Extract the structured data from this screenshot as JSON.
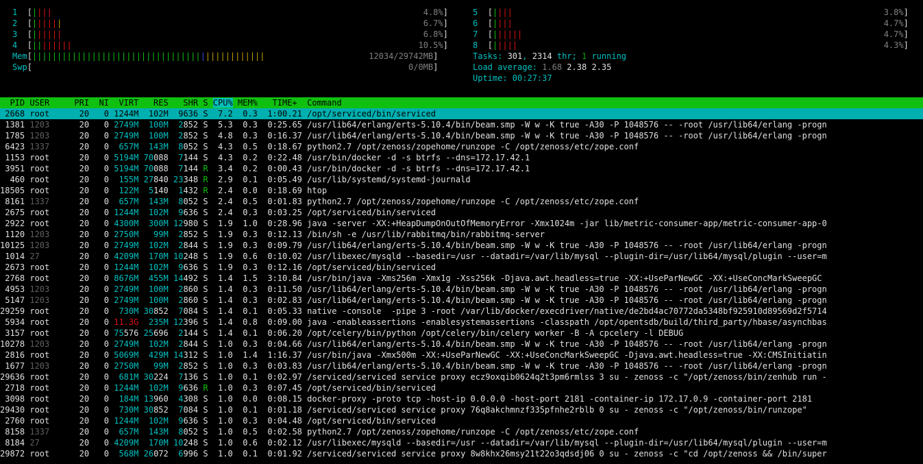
{
  "meters": {
    "cpus_left": [
      {
        "id": "1",
        "bars_green": "|",
        "bars_red": "|||",
        "pct": "4.8%"
      },
      {
        "id": "2",
        "bars_green": "|",
        "bars_red": "||||",
        "bars_yel": "|",
        "pct": "6.7%"
      },
      {
        "id": "3",
        "bars_green": "|",
        "bars_red": "|||||",
        "pct": "6.8%"
      },
      {
        "id": "4",
        "bars_green": "||",
        "bars_red": "||||||",
        "pct": "10.5%"
      }
    ],
    "cpus_right": [
      {
        "id": "5",
        "bars_green": "|",
        "bars_red": "|||",
        "pct": "3.8%"
      },
      {
        "id": "6",
        "bars_green": "|",
        "bars_red": "|||",
        "pct": "4.7%"
      },
      {
        "id": "7",
        "bars_green": "|",
        "bars_red": "|||||",
        "pct": "4.7%"
      },
      {
        "id": "8",
        "bars_green": "|",
        "bars_red": "||||",
        "pct": "4.3%"
      }
    ],
    "mem": {
      "label": "Mem",
      "bars_green": "||||||||||||||||||||||||||||||||||",
      "bars_blue": "|",
      "bars_yel": "||||||||||||",
      "value": "12034/29742MB"
    },
    "swp": {
      "label": "Swp",
      "value": "0/0MB"
    }
  },
  "summary": {
    "tasks_label": "Tasks:",
    "tasks": "301",
    "thr": "2314",
    "thr_label": "thr;",
    "running": "1",
    "running_label": "running",
    "load_label": "Load average:",
    "load1": "1.68",
    "load5": "2.38",
    "load15": "2.35",
    "uptime_label": "Uptime:",
    "uptime": "00:27:37"
  },
  "columns": [
    "PID",
    "USER",
    "PRI",
    "NI",
    "VIRT",
    "RES",
    "SHR",
    "S",
    "CPU%",
    "MEM%",
    "TIME+",
    "Command"
  ],
  "processes": [
    {
      "pid": "2668",
      "user": "root",
      "pri": "20",
      "ni": "0",
      "virt": "1244M",
      "res": "102M",
      "shr": "9636",
      "s": "S",
      "cpu": "7.2",
      "mem": "0.3",
      "time": "1:00.21",
      "cmd": "/opt/serviced/bin/serviced"
    },
    {
      "pid": "1381",
      "user": "1203",
      "pri": "20",
      "ni": "0",
      "virt": "2749M",
      "res": "100M",
      "shr": "2852",
      "s": "S",
      "cpu": "5.3",
      "mem": "0.3",
      "time": "0:25.65",
      "cmd": "/usr/lib64/erlang/erts-5.10.4/bin/beam.smp -W w -K true -A30 -P 1048576 -- -root /usr/lib64/erlang -progn"
    },
    {
      "pid": "1785",
      "user": "1203",
      "pri": "20",
      "ni": "0",
      "virt": "2749M",
      "res": "100M",
      "shr": "2852",
      "s": "S",
      "cpu": "4.8",
      "mem": "0.3",
      "time": "0:16.37",
      "cmd": "/usr/lib64/erlang/erts-5.10.4/bin/beam.smp -W w -K true -A30 -P 1048576 -- -root /usr/lib64/erlang -progn"
    },
    {
      "pid": "6423",
      "user": "1337",
      "pri": "20",
      "ni": "0",
      "virt": "657M",
      "res": "143M",
      "shr": "8052",
      "s": "S",
      "cpu": "4.3",
      "mem": "0.5",
      "time": "0:18.67",
      "cmd": "python2.7 /opt/zenoss/zopehome/runzope -C /opt/zenoss/etc/zope.conf"
    },
    {
      "pid": "1153",
      "user": "root",
      "pri": "20",
      "ni": "0",
      "virt": "5194M",
      "res": "70088",
      "shr": "7144",
      "s": "S",
      "cpu": "4.3",
      "mem": "0.2",
      "time": "0:22.48",
      "cmd": "/usr/bin/docker -d -s btrfs --dns=172.17.42.1"
    },
    {
      "pid": "3951",
      "user": "root",
      "pri": "20",
      "ni": "0",
      "virt": "5194M",
      "res": "70088",
      "shr": "7144",
      "s": "R",
      "cpu": "3.4",
      "mem": "0.2",
      "time": "0:00.43",
      "cmd": "/usr/bin/docker -d -s btrfs --dns=172.17.42.1"
    },
    {
      "pid": "460",
      "user": "root",
      "pri": "20",
      "ni": "0",
      "virt": "155M",
      "res": "27840",
      "shr": "23348",
      "s": "R",
      "cpu": "2.9",
      "mem": "0.1",
      "time": "0:05.49",
      "cmd": "/usr/lib/systemd/systemd-journald"
    },
    {
      "pid": "18505",
      "user": "root",
      "pri": "20",
      "ni": "0",
      "virt": "122M",
      "res": "5140",
      "shr": "1432",
      "s": "R",
      "cpu": "2.4",
      "mem": "0.0",
      "time": "0:18.69",
      "cmd": "htop"
    },
    {
      "pid": "8161",
      "user": "1337",
      "pri": "20",
      "ni": "0",
      "virt": "657M",
      "res": "143M",
      "shr": "8052",
      "s": "S",
      "cpu": "2.4",
      "mem": "0.5",
      "time": "0:01.83",
      "cmd": "python2.7 /opt/zenoss/zopehome/runzope -C /opt/zenoss/etc/zope.conf"
    },
    {
      "pid": "2675",
      "user": "root",
      "pri": "20",
      "ni": "0",
      "virt": "1244M",
      "res": "102M",
      "shr": "9636",
      "s": "S",
      "cpu": "2.4",
      "mem": "0.3",
      "time": "0:03.25",
      "cmd": "/opt/serviced/bin/serviced"
    },
    {
      "pid": "2922",
      "user": "root",
      "pri": "20",
      "ni": "0",
      "virt": "4300M",
      "res": "300M",
      "shr": "12980",
      "s": "S",
      "cpu": "1.9",
      "mem": "1.0",
      "time": "0:28.96",
      "cmd": "java -server -XX:+HeapDumpOnOutOfMemoryError -Xmx1024m -jar lib/metric-consumer-app/metric-consumer-app-0"
    },
    {
      "pid": "1120",
      "user": "1203",
      "pri": "20",
      "ni": "0",
      "virt": "2750M",
      "res": "99M",
      "shr": "2852",
      "s": "S",
      "cpu": "1.9",
      "mem": "0.3",
      "time": "0:12.13",
      "cmd": "/bin/sh -e /usr/lib/rabbitmq/bin/rabbitmq-server"
    },
    {
      "pid": "10125",
      "user": "1203",
      "pri": "20",
      "ni": "0",
      "virt": "2749M",
      "res": "102M",
      "shr": "2844",
      "s": "S",
      "cpu": "1.9",
      "mem": "0.3",
      "time": "0:09.79",
      "cmd": "/usr/lib64/erlang/erts-5.10.4/bin/beam.smp -W w -K true -A30 -P 1048576 -- -root /usr/lib64/erlang -progn"
    },
    {
      "pid": "1014",
      "user": "27",
      "pri": "20",
      "ni": "0",
      "virt": "4209M",
      "res": "170M",
      "shr": "10248",
      "s": "S",
      "cpu": "1.9",
      "mem": "0.6",
      "time": "0:10.02",
      "cmd": "/usr/libexec/mysqld --basedir=/usr --datadir=/var/lib/mysql --plugin-dir=/usr/lib64/mysql/plugin --user=m"
    },
    {
      "pid": "2673",
      "user": "root",
      "pri": "20",
      "ni": "0",
      "virt": "1244M",
      "res": "102M",
      "shr": "9636",
      "s": "S",
      "cpu": "1.9",
      "mem": "0.3",
      "time": "0:12.16",
      "cmd": "/opt/serviced/bin/serviced"
    },
    {
      "pid": "2768",
      "user": "root",
      "pri": "20",
      "ni": "0",
      "virt": "8676M",
      "res": "455M",
      "shr": "14492",
      "s": "S",
      "cpu": "1.4",
      "mem": "1.5",
      "time": "3:10.84",
      "cmd": "/usr/bin/java -Xms256m -Xmx1g -Xss256k -Djava.awt.headless=true -XX:+UseParNewGC -XX:+UseConcMarkSweepGC"
    },
    {
      "pid": "4953",
      "user": "1203",
      "pri": "20",
      "ni": "0",
      "virt": "2749M",
      "res": "100M",
      "shr": "2860",
      "s": "S",
      "cpu": "1.4",
      "mem": "0.3",
      "time": "0:11.50",
      "cmd": "/usr/lib64/erlang/erts-5.10.4/bin/beam.smp -W w -K true -A30 -P 1048576 -- -root /usr/lib64/erlang -progn"
    },
    {
      "pid": "5147",
      "user": "1203",
      "pri": "20",
      "ni": "0",
      "virt": "2749M",
      "res": "100M",
      "shr": "2860",
      "s": "S",
      "cpu": "1.4",
      "mem": "0.3",
      "time": "0:02.83",
      "cmd": "/usr/lib64/erlang/erts-5.10.4/bin/beam.smp -W w -K true -A30 -P 1048576 -- -root /usr/lib64/erlang -progn"
    },
    {
      "pid": "29259",
      "user": "root",
      "pri": "20",
      "ni": "0",
      "virt": "730M",
      "res": "30852",
      "shr": "7084",
      "s": "S",
      "cpu": "1.4",
      "mem": "0.1",
      "time": "0:05.33",
      "cmd": "native -console  -pipe 3 -root /var/lib/docker/execdriver/native/de2bd4ac70772da5348bf925910d89569d2f5714"
    },
    {
      "pid": "5934",
      "user": "root",
      "pri": "20",
      "ni": "0",
      "virt": "11.3G",
      "res": "235M",
      "shr": "12396",
      "s": "S",
      "cpu": "1.4",
      "mem": "0.8",
      "time": "0:09.00",
      "cmd": "java -enableassertions -enablesystemassertions -classpath /opt/opentsdb/build/third_party/hbase/asynchbas"
    },
    {
      "pid": "3157",
      "user": "root",
      "pri": "20",
      "ni": "0",
      "virt": "75576",
      "res": "25696",
      "shr": "2144",
      "s": "S",
      "cpu": "1.4",
      "mem": "0.1",
      "time": "0:06.20",
      "cmd": "/opt/celery/bin/python /opt/celery/bin/celery worker -B -A cpcelery -l DEBUG"
    },
    {
      "pid": "10278",
      "user": "1203",
      "pri": "20",
      "ni": "0",
      "virt": "2749M",
      "res": "102M",
      "shr": "2844",
      "s": "S",
      "cpu": "1.0",
      "mem": "0.3",
      "time": "0:04.66",
      "cmd": "/usr/lib64/erlang/erts-5.10.4/bin/beam.smp -W w -K true -A30 -P 1048576 -- -root /usr/lib64/erlang -progn"
    },
    {
      "pid": "2816",
      "user": "root",
      "pri": "20",
      "ni": "0",
      "virt": "5069M",
      "res": "429M",
      "shr": "14312",
      "s": "S",
      "cpu": "1.0",
      "mem": "1.4",
      "time": "1:16.37",
      "cmd": "/usr/bin/java -Xmx500m -XX:+UseParNewGC -XX:+UseConcMarkSweepGC -Djava.awt.headless=true -XX:CMSInitiatin"
    },
    {
      "pid": "1677",
      "user": "1203",
      "pri": "20",
      "ni": "0",
      "virt": "2750M",
      "res": "99M",
      "shr": "2852",
      "s": "S",
      "cpu": "1.0",
      "mem": "0.3",
      "time": "0:03.83",
      "cmd": "/usr/lib64/erlang/erts-5.10.4/bin/beam.smp -W w -K true -A30 -P 1048576 -- -root /usr/lib64/erlang -progn"
    },
    {
      "pid": "29636",
      "user": "root",
      "pri": "20",
      "ni": "0",
      "virt": "681M",
      "res": "30224",
      "shr": "7136",
      "s": "S",
      "cpu": "1.0",
      "mem": "0.1",
      "time": "0:02.97",
      "cmd": "/serviced/serviced service proxy ecz9oxqib0624q2t3pm6rmlss 3 su - zenoss -c \"/opt/zenoss/bin/zenhub run -"
    },
    {
      "pid": "2718",
      "user": "root",
      "pri": "20",
      "ni": "0",
      "virt": "1244M",
      "res": "102M",
      "shr": "9636",
      "s": "R",
      "cpu": "1.0",
      "mem": "0.3",
      "time": "0:07.45",
      "cmd": "/opt/serviced/bin/serviced"
    },
    {
      "pid": "3098",
      "user": "root",
      "pri": "20",
      "ni": "0",
      "virt": "184M",
      "res": "13960",
      "shr": "4308",
      "s": "S",
      "cpu": "1.0",
      "mem": "0.0",
      "time": "0:08.15",
      "cmd": "docker-proxy -proto tcp -host-ip 0.0.0.0 -host-port 2181 -container-ip 172.17.0.9 -container-port 2181"
    },
    {
      "pid": "29430",
      "user": "root",
      "pri": "20",
      "ni": "0",
      "virt": "730M",
      "res": "30852",
      "shr": "7084",
      "s": "S",
      "cpu": "1.0",
      "mem": "0.1",
      "time": "0:01.18",
      "cmd": "/serviced/serviced service proxy 76q8akchmnzf335pfnhe2rblb 0 su - zenoss -c \"/opt/zenoss/bin/runzope\""
    },
    {
      "pid": "2760",
      "user": "root",
      "pri": "20",
      "ni": "0",
      "virt": "1244M",
      "res": "102M",
      "shr": "9636",
      "s": "S",
      "cpu": "1.0",
      "mem": "0.3",
      "time": "0:04.48",
      "cmd": "/opt/serviced/bin/serviced"
    },
    {
      "pid": "8158",
      "user": "1337",
      "pri": "20",
      "ni": "0",
      "virt": "657M",
      "res": "143M",
      "shr": "8052",
      "s": "S",
      "cpu": "1.0",
      "mem": "0.5",
      "time": "0:02.58",
      "cmd": "python2.7 /opt/zenoss/zopehome/runzope -C /opt/zenoss/etc/zope.conf"
    },
    {
      "pid": "8184",
      "user": "27",
      "pri": "20",
      "ni": "0",
      "virt": "4209M",
      "res": "170M",
      "shr": "10248",
      "s": "S",
      "cpu": "1.0",
      "mem": "0.6",
      "time": "0:02.12",
      "cmd": "/usr/libexec/mysqld --basedir=/usr --datadir=/var/lib/mysql --plugin-dir=/usr/lib64/mysql/plugin --user=m"
    },
    {
      "pid": "29872",
      "user": "root",
      "pri": "20",
      "ni": "0",
      "virt": "568M",
      "res": "26072",
      "shr": "6996",
      "s": "S",
      "cpu": "1.0",
      "mem": "0.1",
      "time": "0:01.92",
      "cmd": "/serviced/serviced service proxy 8w8khx26msy21t22o3qdsdj06 0 su - zenoss -c \"cd /opt/zenoss && /bin/super"
    }
  ]
}
